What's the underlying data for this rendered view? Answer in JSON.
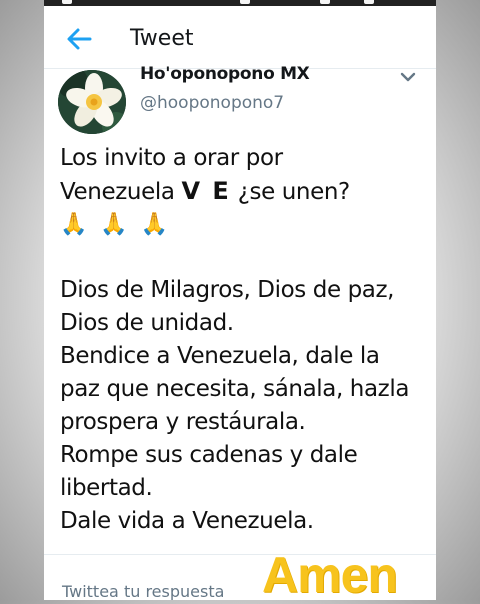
{
  "header": {
    "title": "Tweet",
    "back_icon": "back-arrow-icon",
    "accent_color": "#1da1f2"
  },
  "tweet": {
    "display_name": "Ho'oponopono MX",
    "handle": "@hooponopono7",
    "lines": [
      "Los invito a orar por",
      "Venezuela",
      "V E",
      "¿se unen?",
      "🙏 🙏 🙏",
      "Dios de Milagros, Dios de paz,",
      "Dios de unidad.",
      "Bendice a Venezuela, dale la",
      "paz que necesita, sánala, hazla",
      "prospera y restáurala.",
      "Rompe sus cadenas y dale",
      "libertad.",
      "Dale vida a Venezuela."
    ]
  },
  "reply": {
    "placeholder": "Twittea tu respuesta"
  },
  "overlay": {
    "caption": "Amen",
    "color": "#f7c31d"
  }
}
